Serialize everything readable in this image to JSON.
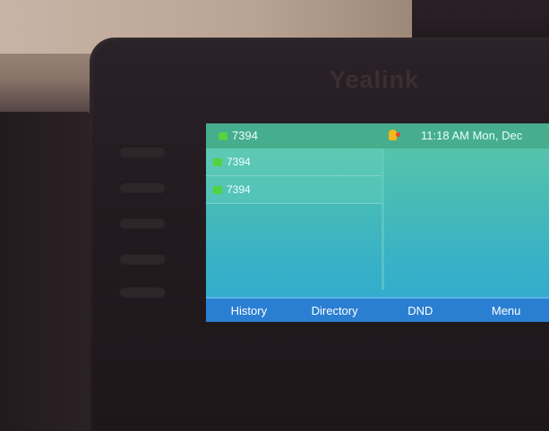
{
  "brand": "Yealink",
  "status": {
    "line": "7394",
    "clock": "11:18 AM Mon, Dec"
  },
  "lines": [
    {
      "label": "7394"
    },
    {
      "label": "7394"
    }
  ],
  "softkeys": [
    "History",
    "Directory",
    "DND",
    "Menu"
  ],
  "colors": {
    "line_indicator": "#55d23f",
    "softkey_bar": "#2a7fd2",
    "status_bar": "#46ad8d"
  }
}
